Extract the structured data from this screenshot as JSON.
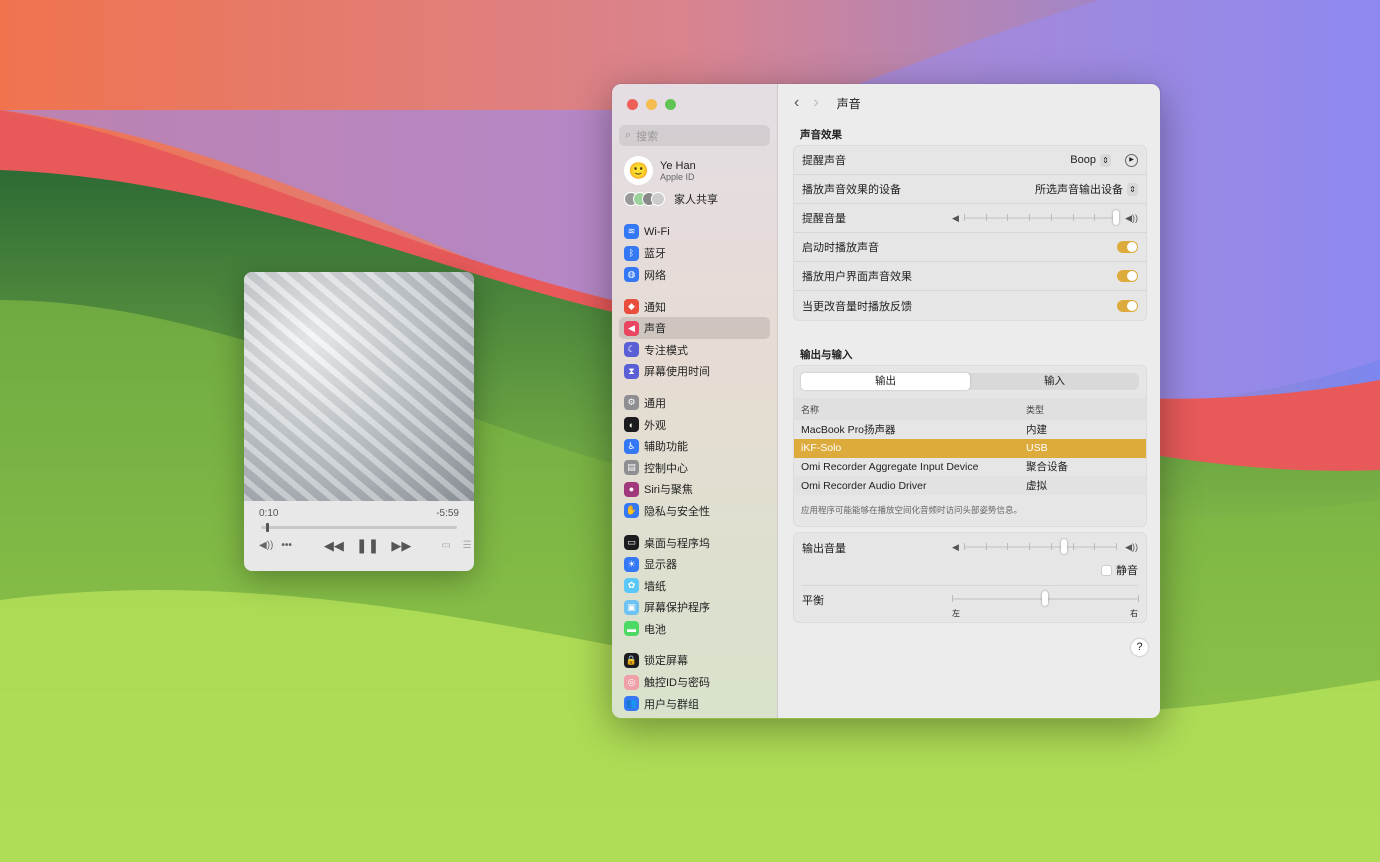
{
  "window": {
    "traffic_lights": [
      "#ee5f57",
      "#f5bd4f",
      "#5fc453"
    ]
  },
  "sidebar": {
    "search_placeholder": "搜索",
    "account": {
      "name": "Ye Han",
      "subtitle": "Apple ID"
    },
    "family_label": "家人共享",
    "groups": [
      [
        {
          "label": "Wi-Fi",
          "icon": "wifi-icon",
          "color": "#3478f6",
          "glyph": "≋"
        },
        {
          "label": "蓝牙",
          "icon": "bluetooth-icon",
          "color": "#3478f6",
          "glyph": "ᛒ"
        },
        {
          "label": "网络",
          "icon": "network-globe-icon",
          "color": "#3478f6",
          "glyph": "◍"
        }
      ],
      [
        {
          "label": "通知",
          "icon": "notification-bell-icon",
          "color": "#eb4d3d",
          "glyph": "◆"
        },
        {
          "label": "声音",
          "icon": "speaker-icon",
          "color": "#ea4561",
          "glyph": "◀",
          "selected": true
        },
        {
          "label": "专注模式",
          "icon": "moon-icon",
          "color": "#5a5fd6",
          "glyph": "☾"
        },
        {
          "label": "屏幕使用时间",
          "icon": "hourglass-icon",
          "color": "#5a5fd6",
          "glyph": "⧗"
        }
      ],
      [
        {
          "label": "通用",
          "icon": "gear-icon",
          "color": "#8e8e93",
          "glyph": "⚙"
        },
        {
          "label": "外观",
          "icon": "appearance-icon",
          "color": "#1c1c1e",
          "glyph": "◐"
        },
        {
          "label": "辅助功能",
          "icon": "accessibility-icon",
          "color": "#3478f6",
          "glyph": "♿"
        },
        {
          "label": "控制中心",
          "icon": "control-center-icon",
          "color": "#8e8e93",
          "glyph": "▤"
        },
        {
          "label": "Siri与聚焦",
          "icon": "siri-icon",
          "color": "#a03a7d",
          "glyph": "●"
        },
        {
          "label": "隐私与安全性",
          "icon": "hand-icon",
          "color": "#3478f6",
          "glyph": "✋"
        }
      ],
      [
        {
          "label": "桌面与程序坞",
          "icon": "dock-icon",
          "color": "#1c1c1e",
          "glyph": "▭"
        },
        {
          "label": "显示器",
          "icon": "display-brightness-icon",
          "color": "#3478f6",
          "glyph": "☀"
        },
        {
          "label": "墙纸",
          "icon": "wallpaper-icon",
          "color": "#5ac8fa",
          "glyph": "✿"
        },
        {
          "label": "屏幕保护程序",
          "icon": "screensaver-icon",
          "color": "#6ec3f2",
          "glyph": "▣"
        },
        {
          "label": "电池",
          "icon": "battery-icon",
          "color": "#4cd964",
          "glyph": "▬"
        }
      ],
      [
        {
          "label": "锁定屏幕",
          "icon": "lock-icon",
          "color": "#1c1c1e",
          "glyph": "🔒"
        },
        {
          "label": "触控ID与密码",
          "icon": "fingerprint-icon",
          "color": "#f0a0a8",
          "glyph": "◎"
        },
        {
          "label": "用户与群组",
          "icon": "users-icon",
          "color": "#3478f6",
          "glyph": "👥"
        }
      ]
    ]
  },
  "main": {
    "title": "声音",
    "effects": {
      "heading": "声音效果",
      "alert_sound_label": "提醒声音",
      "alert_sound_value": "Boop",
      "device_label": "播放声音效果的设备",
      "device_value": "所选声音输出设备",
      "alert_volume_label": "提醒音量",
      "alert_volume": 1.0,
      "toggles": [
        {
          "label": "启动时播放声音",
          "on": true
        },
        {
          "label": "播放用户界面声音效果",
          "on": true
        },
        {
          "label": "当更改音量时播放反馈",
          "on": true
        }
      ],
      "accent": "#dcab3c"
    },
    "io": {
      "heading": "输出与输入",
      "tabs": [
        "输出",
        "输入"
      ],
      "active_tab": "输出",
      "columns": [
        "名称",
        "类型"
      ],
      "rows": [
        [
          "MacBook Pro扬声器",
          "内建"
        ],
        [
          "iKF-Solo",
          "USB"
        ],
        [
          "Omi Recorder Aggregate Input Device",
          "聚合设备"
        ],
        [
          "Omi Recorder Audio Driver",
          "虚拟"
        ]
      ],
      "selected_row": 1,
      "note": "应用程序可能能够在播放空间化音频时访问头部姿势信息。"
    },
    "output": {
      "volume_label": "输出音量",
      "volume": 0.66,
      "mute_label": "静音",
      "muted": false,
      "balance_label": "平衡",
      "balance": 0.5,
      "left": "左",
      "right": "右"
    },
    "help": "?"
  },
  "player": {
    "elapsed": "0:10",
    "remaining": "-5:59",
    "progress": 0.027
  }
}
